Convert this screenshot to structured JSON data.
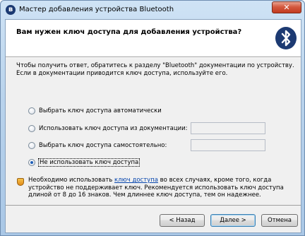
{
  "window": {
    "title": "Мастер добавления устройства Bluetooth",
    "close_glyph": "✕",
    "app_icon_glyph": "ʙ"
  },
  "header": {
    "title": "Вам нужен ключ доступа для добавления устройства?"
  },
  "intro": {
    "line1": "Чтобы получить ответ, обратитесь к разделу \"Bluetooth\" документации по устройству.",
    "line2": "Если в документации приводится ключ доступа, используйте его."
  },
  "options": [
    {
      "label": "Выбрать ключ доступа автоматически",
      "checked": false
    },
    {
      "label": "Использовать ключ доступа из документации:",
      "checked": false,
      "field_value": ""
    },
    {
      "label": "Выбрать ключ доступа самостоятельно:",
      "checked": false,
      "field_value": ""
    },
    {
      "label": "Не использовать ключ доступа",
      "checked": true
    }
  ],
  "info": {
    "text_before": "Необходимо использовать ",
    "link": "ключ доступа",
    "text_after": " во всех случаях, кроме того, когда устройство не поддерживает ключ. Рекомендуется использовать ключ доступа длиной от 8 до 16 знаков. Чем длиннее ключ доступа, тем он надежнее."
  },
  "buttons": {
    "back": "< Назад",
    "next": "Далее >",
    "cancel": "Отмена"
  },
  "colors": {
    "bluetooth_logo": "#1c3a72",
    "link": "#0645ad",
    "close_button": "#c23a20"
  }
}
